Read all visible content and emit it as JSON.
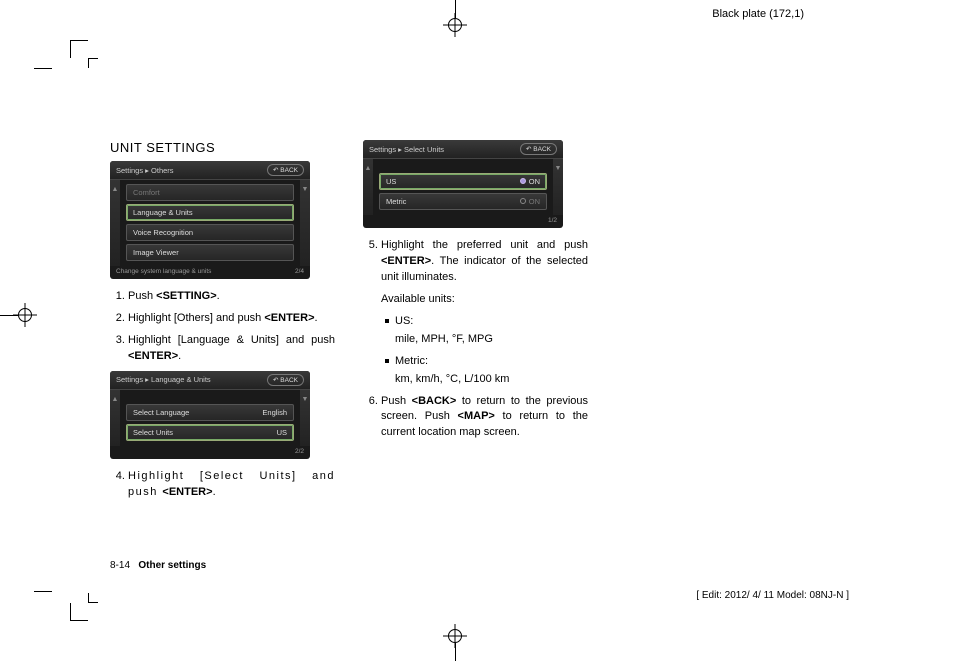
{
  "plate_label": "Black plate (172,1)",
  "section_title": "UNIT SETTINGS",
  "screenshot1": {
    "breadcrumb": "Settings ▸ Others",
    "back": "↶ BACK",
    "rows": [
      "Comfort",
      "Language & Units",
      "Voice Recognition",
      "Image Viewer"
    ],
    "hint": "Change system language & units",
    "page": "2/4"
  },
  "screenshot2": {
    "breadcrumb": "Settings ▸ Language & Units",
    "back": "↶ BACK",
    "rows": [
      {
        "label": "Select Language",
        "value": "English"
      },
      {
        "label": "Select Units",
        "value": "US"
      }
    ],
    "page": "2/2"
  },
  "screenshot3": {
    "breadcrumb": "Settings ▸ Select Units",
    "back": "↶ BACK",
    "rows": [
      {
        "label": "US",
        "state": "ON",
        "on": true
      },
      {
        "label": "Metric",
        "state": "ON",
        "on": false
      }
    ],
    "page": "1/2"
  },
  "steps": {
    "s1_a": "Push ",
    "s1_b": "<SETTING>",
    "s1_c": ".",
    "s2_a": "Highlight [Others] and push ",
    "s2_b": "<ENTER>",
    "s2_c": ".",
    "s3_a": "Highlight [Language & Units] and push ",
    "s3_b": "<ENTER>",
    "s3_c": ".",
    "s4_a": "Highlight [Select Units] and push ",
    "s4_b": "<ENTER>",
    "s4_c": ".",
    "s5_a": "Highlight the preferred unit and push ",
    "s5_b": "<ENTER>",
    "s5_c": ". The indicator of the selected unit illuminates.",
    "s5_avail": "Available units:",
    "s5_us_label": "US:",
    "s5_us_detail": "mile, MPH, °F, MPG",
    "s5_metric_label": "Metric:",
    "s5_metric_detail": "km, km/h, °C, L/100 km",
    "s6_a": "Push ",
    "s6_b": "<BACK>",
    "s6_c": " to return to the previous screen. Push ",
    "s6_d": "<MAP>",
    "s6_e": " to return to the current location map screen."
  },
  "footer": {
    "page_num": "8-14",
    "section": "Other settings",
    "edit_info": "[ Edit: 2012/ 4/ 11   Model: 08NJ-N ]"
  }
}
